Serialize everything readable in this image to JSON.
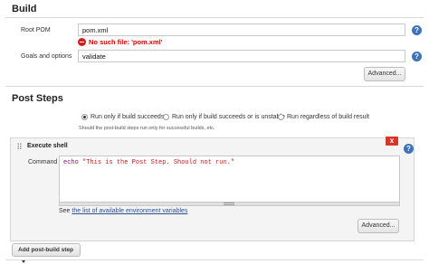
{
  "build": {
    "heading": "Build",
    "root_pom_label": "Root POM",
    "root_pom_value": "pom.xml",
    "error_text": "No such file: 'pom.xml'",
    "goals_label": "Goals and options",
    "goals_value": "validate",
    "advanced_label": "Advanced..."
  },
  "post_steps": {
    "heading": "Post Steps",
    "options": [
      {
        "label": "Run only if build succeeds",
        "selected": true
      },
      {
        "label": "Run only if build succeeds or is unstable",
        "selected": false
      },
      {
        "label": "Run regardless of build result",
        "selected": false
      }
    ],
    "hint": "Should the post-build steps run only for successful builds, etc."
  },
  "execute_shell": {
    "title": "Execute shell",
    "close_label": "x",
    "command_label": "Command",
    "command_keyword": "echo",
    "command_string": "\"This is the Post Step. Should not run.\"",
    "see_prefix": "See",
    "see_link": "the list of available environment variables",
    "advanced_label": "Advanced..."
  },
  "add_step_label": "Add post-build step",
  "help_label": "?",
  "colors": {
    "help": "#3f73b9",
    "error": "#cc1f1f",
    "close": "#d9352b",
    "link": "#2b4f8f"
  },
  "icons": [
    "help-icon",
    "error-icon",
    "close-icon",
    "drag-handle-icon",
    "dropdown-caret-icon"
  ]
}
